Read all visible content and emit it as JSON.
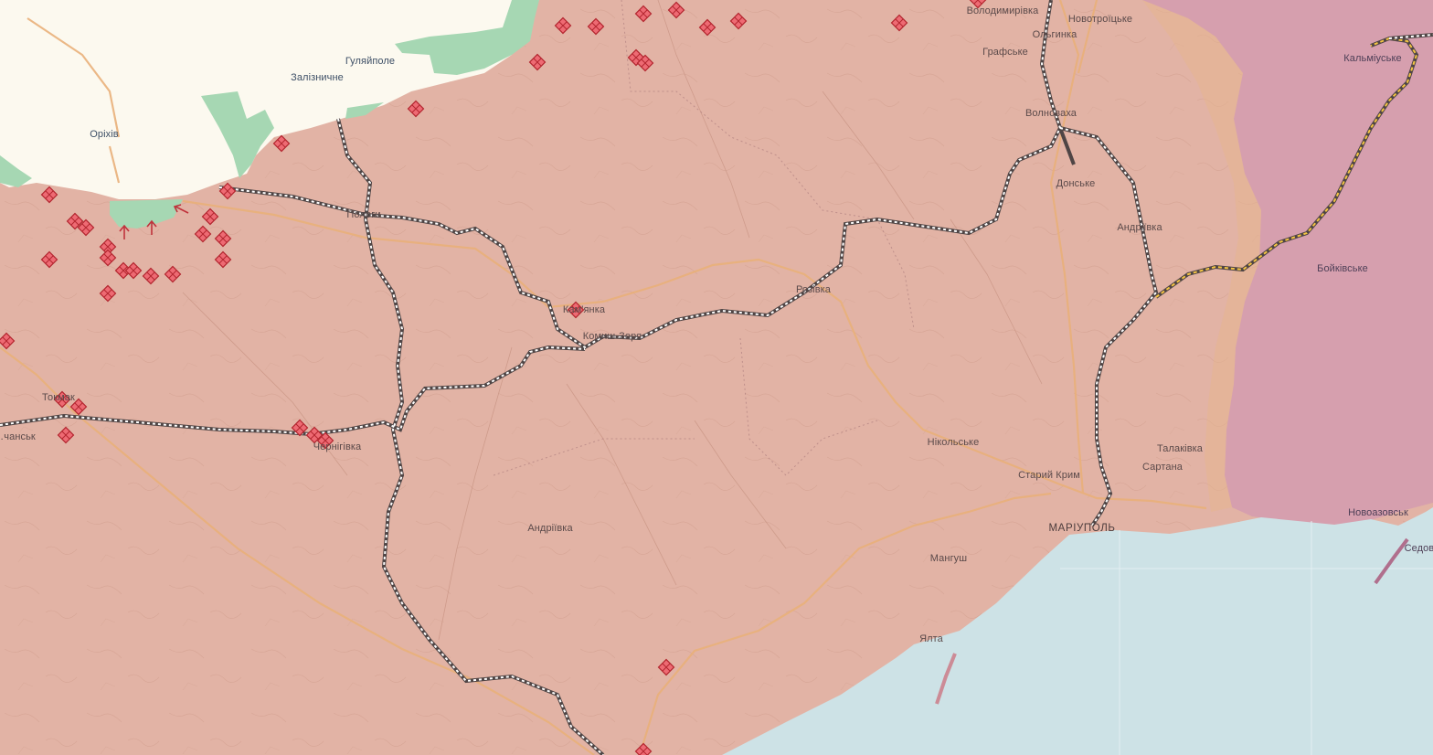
{
  "map": {
    "colors": {
      "occupied": "#e2b3a5",
      "occupied_before_2022": "#d69fae",
      "ukraine_controlled": "#fcf9ef",
      "liberated": "#a6d7b3",
      "sea": "#cde2e6",
      "roads": "#e9b07a",
      "strike_marker": "#e84d5a"
    },
    "labels": {
      "volodymyrivka": "Володимирівка",
      "novotroitske": "Новотроїцьке",
      "olhynka": "Ольгинка",
      "hrafske": "Графське",
      "huliaipole": "Гуляйполе",
      "zaliznychne": "Залізничне",
      "orikhiv": "Оріхів",
      "kalmiuske": "Кальміуське",
      "volnovakha": "Волноваха",
      "donske": "Донське",
      "andriivka_ne": "Андріївка",
      "boikivske": "Бойківське",
      "polohy": "Пологи",
      "kuibysheve": "Комиш-Зоря",
      "rozivka": "Розівка",
      "kamianka": "Кам'янка",
      "tokmak": "Токмак",
      "molochansk": "…чанськ",
      "chernihivka": "Чернігівка",
      "nikolske": "Нікольське",
      "talakivka": "Талаківка",
      "sartana": "Сартана",
      "staryi_krym": "Старий Крим",
      "mariupol": "МАРІУПОЛЬ",
      "novoazovsk": "Новоазовськ",
      "sedove": "Седово",
      "andriivka_s": "Андріївка",
      "manhush": "Мангуш",
      "yalta": "Ялта"
    },
    "icons": {
      "strike": "explosion-marker-icon",
      "advance": "arrow-up-icon"
    }
  }
}
